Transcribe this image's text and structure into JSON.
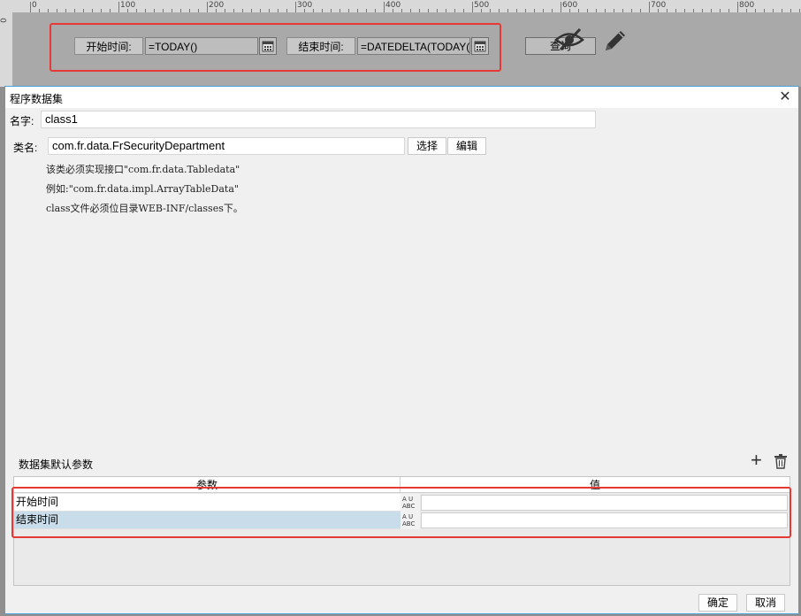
{
  "ruler": {
    "top_ticks": [
      "0",
      "100",
      "200",
      "300",
      "400",
      "500",
      "600",
      "700",
      "800"
    ],
    "left_zero": "0"
  },
  "designer": {
    "start_label": "开始时间:",
    "start_value": "=TODAY()",
    "end_label": "结束时间:",
    "end_value": "=DATEDELTA(TODAY(",
    "query_label": "查询"
  },
  "dialog": {
    "title": "程序数据集",
    "close_glyph": "✕",
    "name_label": "名字:",
    "name_value": "class1",
    "class_label": "类名:",
    "class_value": "com.fr.data.FrSecurityDepartment",
    "select_button": "选择",
    "edit_button": "编辑",
    "hints": [
      "该类必须实现接口\"com.fr.data.Tabledata\"",
      "例如:\"com.fr.data.impl.ArrayTableData\"",
      "class文件必须位目录WEB-INF/classes下。"
    ],
    "params_title": "数据集默认参数",
    "add_glyph": "+",
    "columns": [
      "参数",
      "值"
    ],
    "rows": [
      {
        "name": "开始时间",
        "value": "",
        "selected": false
      },
      {
        "name": "结束时间",
        "value": "",
        "selected": true
      }
    ],
    "type_icon_text": "A U\nABC",
    "ok_button": "确定",
    "cancel_button": "取消"
  },
  "colors": {
    "highlight_red": "#e53935",
    "selected_row": "#c9dcea",
    "dialog_border": "#4ba0d8"
  }
}
